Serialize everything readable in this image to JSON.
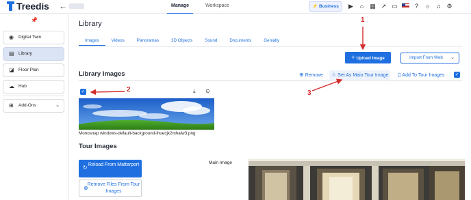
{
  "topbar": {
    "logo_text": "Treedis",
    "nav": [
      "Manage",
      "Workspace"
    ],
    "active_nav": "Manage",
    "business_label": "Business",
    "icons": [
      "play-icon",
      "home-icon",
      "building-icon",
      "chart-icon",
      "credit-card-icon",
      "us-flag-icon",
      "help-icon",
      "lightbulb-icon",
      "bell-icon",
      "settings-icon"
    ]
  },
  "sidebar": {
    "items": [
      {
        "label": "Digital Twin",
        "icon": "eye-icon"
      },
      {
        "label": "Library",
        "icon": "library-icon"
      },
      {
        "label": "Floor Plan",
        "icon": "floor-plan-icon"
      },
      {
        "label": "Hub",
        "icon": "hub-icon"
      },
      {
        "label": "Add-Ons",
        "icon": "grid-icon"
      }
    ]
  },
  "main": {
    "title": "Library",
    "tabs": [
      "Images",
      "Videos",
      "Panoramas",
      "3D Objects",
      "Sound",
      "Documents",
      "Genially"
    ],
    "upload_label": "Upload Image",
    "import_label": "Import From Web",
    "library_images_title": "Library Images",
    "actions": {
      "remove": "Remove",
      "set_main": "Set As Main Tour Image",
      "add_tour": "Add To Tour Images"
    },
    "image_caption": "Monosnap windows-default-background-ihuecjk2mhalw3.png",
    "tour_images_title": "Tour Images",
    "reload_label": "Reload From Matterport",
    "remove_files_label": "Remove Files From Tour Images",
    "main_image_label": "Main Image"
  },
  "annotations": [
    "1",
    "2",
    "3"
  ],
  "colors": {
    "accent": "#1f6fe0",
    "annotation": "#d52b2b"
  }
}
